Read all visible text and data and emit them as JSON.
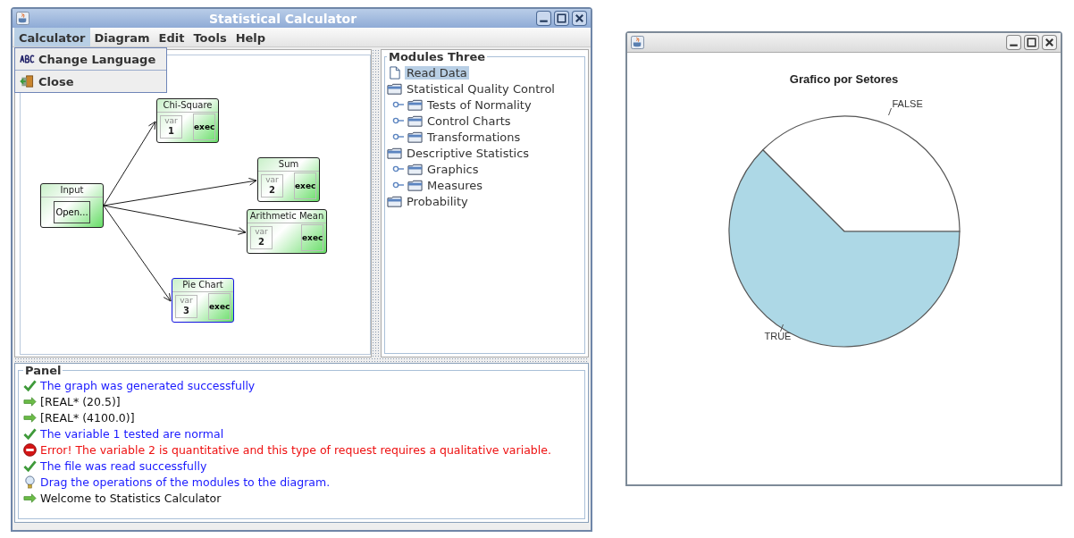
{
  "main_window": {
    "title": "Statistical Calculator",
    "menu": [
      {
        "label": "Calculator",
        "selected": true
      },
      {
        "label": "Diagram",
        "selected": false
      },
      {
        "label": "Edit",
        "selected": false
      },
      {
        "label": "Tools",
        "selected": false
      },
      {
        "label": "Help",
        "selected": false
      }
    ],
    "open_menu": {
      "items": [
        {
          "label": "Change Language",
          "kind": "language"
        },
        {
          "label": "Close",
          "kind": "exit"
        }
      ]
    },
    "diagram": {
      "nodes": [
        {
          "kind": "input",
          "title": "Input",
          "button": "Open...",
          "selected": false
        },
        {
          "kind": "operation",
          "title": "Chi-Square",
          "var_label": "var",
          "var": "1",
          "exec": "exec",
          "selected": false
        },
        {
          "kind": "operation",
          "title": "Sum",
          "var_label": "var",
          "var": "2",
          "exec": "exec",
          "selected": false
        },
        {
          "kind": "operation",
          "title": "Arithmetic Mean",
          "var_label": "var",
          "var": "2",
          "exec": "exec",
          "selected": false
        },
        {
          "kind": "operation",
          "title": "Pie Chart",
          "var_label": "var",
          "var": "3",
          "exec": "exec",
          "selected": true
        }
      ]
    },
    "tree": {
      "title": "Modules Three",
      "items": [
        {
          "label": "Read Data",
          "kind": "file",
          "selected": true
        },
        {
          "label": "Statistical Quality Control",
          "kind": "folder",
          "selected": false,
          "children": [
            {
              "label": "Tests of Normality",
              "kind": "folder",
              "selected": false,
              "expanded": false
            },
            {
              "label": "Control Charts",
              "kind": "folder",
              "selected": false,
              "expanded": false
            },
            {
              "label": "Transformations",
              "kind": "folder",
              "selected": false,
              "expanded": false
            }
          ]
        },
        {
          "label": "Descriptive Statistics",
          "kind": "folder",
          "selected": false,
          "children": [
            {
              "label": "Graphics",
              "kind": "folder",
              "selected": false,
              "expanded": false
            },
            {
              "label": "Measures",
              "kind": "folder",
              "selected": false,
              "expanded": false
            }
          ]
        },
        {
          "label": "Probability",
          "kind": "folder",
          "selected": false
        }
      ]
    },
    "panel": {
      "title": "Panel",
      "messages": [
        {
          "kind": "success",
          "text": "The graph was generated successfully"
        },
        {
          "kind": "result",
          "text": "[REAL* (20.5)]"
        },
        {
          "kind": "result",
          "text": "[REAL* (4100.0)]"
        },
        {
          "kind": "success",
          "text": "The variable 1 tested are normal"
        },
        {
          "kind": "error",
          "text": "Error! The variable 2 is quantitative and this type of request requires a qualitative variable."
        },
        {
          "kind": "success",
          "text": "The file was read successfully"
        },
        {
          "kind": "hint",
          "text": "Drag the operations of the modules to the diagram."
        },
        {
          "kind": "result",
          "text": "Welcome to Statistics Calculator"
        }
      ]
    }
  },
  "chart_window": {
    "title": "Grafico por Setores",
    "slices": [
      {
        "label": "FALSE",
        "color": "#ffffff"
      },
      {
        "label": "TRUE",
        "color": "#add8e6"
      }
    ]
  }
}
